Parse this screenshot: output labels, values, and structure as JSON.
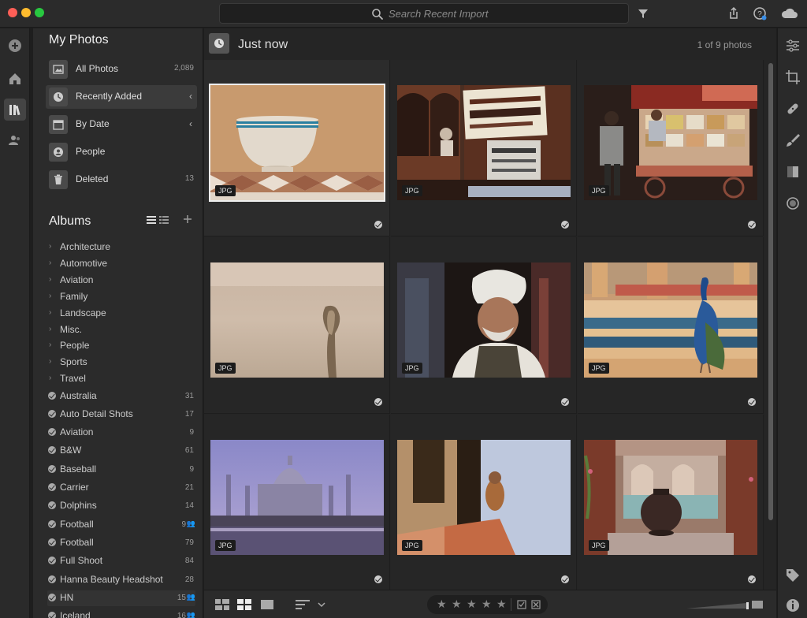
{
  "search": {
    "placeholder": "Search Recent Import"
  },
  "sidebar": {
    "my_photos_title": "My Photos",
    "nav": [
      {
        "label": "All Photos",
        "count": "2,089",
        "icon": "image-icon"
      },
      {
        "label": "Recently Added",
        "count": "",
        "icon": "clock-icon",
        "active": true
      },
      {
        "label": "By Date",
        "count": "",
        "icon": "calendar-icon"
      },
      {
        "label": "People",
        "count": "",
        "icon": "person-icon"
      },
      {
        "label": "Deleted",
        "count": "13",
        "icon": "trash-icon"
      }
    ],
    "albums_title": "Albums",
    "folders": [
      "Architecture",
      "Automotive",
      "Aviation",
      "Family",
      "Landscape",
      "Misc.",
      "People",
      "Sports",
      "Travel"
    ],
    "albums": [
      {
        "label": "Australia",
        "count": "31"
      },
      {
        "label": "Auto Detail Shots",
        "count": "17"
      },
      {
        "label": "Aviation",
        "count": "9"
      },
      {
        "label": "B&W",
        "count": "61"
      },
      {
        "label": "Baseball",
        "count": "9"
      },
      {
        "label": "Carrier",
        "count": "21"
      },
      {
        "label": "Dolphins",
        "count": "14"
      },
      {
        "label": "Football",
        "count": "9",
        "shared": true
      },
      {
        "label": "Football",
        "count": "79"
      },
      {
        "label": "Full Shoot",
        "count": "84"
      },
      {
        "label": "Hanna Beauty Headshot",
        "count": "28"
      },
      {
        "label": "HN",
        "count": "15",
        "shared": true
      },
      {
        "label": "Iceland",
        "count": "16",
        "shared": true
      }
    ]
  },
  "main": {
    "title": "Just now",
    "count_text": "1 of 9 photos",
    "photos": [
      {
        "format": "JPG",
        "subject": "bowl-on-tiles",
        "selected": true
      },
      {
        "format": "JPG",
        "subject": "temple-signs"
      },
      {
        "format": "JPG",
        "subject": "street-vendor-cart"
      },
      {
        "format": "JPG",
        "subject": "cobra"
      },
      {
        "format": "JPG",
        "subject": "man-in-turban"
      },
      {
        "format": "JPG",
        "subject": "peacock"
      },
      {
        "format": "JPG",
        "subject": "taj-mahal"
      },
      {
        "format": "JPG",
        "subject": "woman-in-doorway"
      },
      {
        "format": "JPG",
        "subject": "courtyard-urn"
      }
    ]
  },
  "colors": {
    "background": "#1e1e1e",
    "panel": "#2b2b2b",
    "selection": "#eeeeee"
  }
}
